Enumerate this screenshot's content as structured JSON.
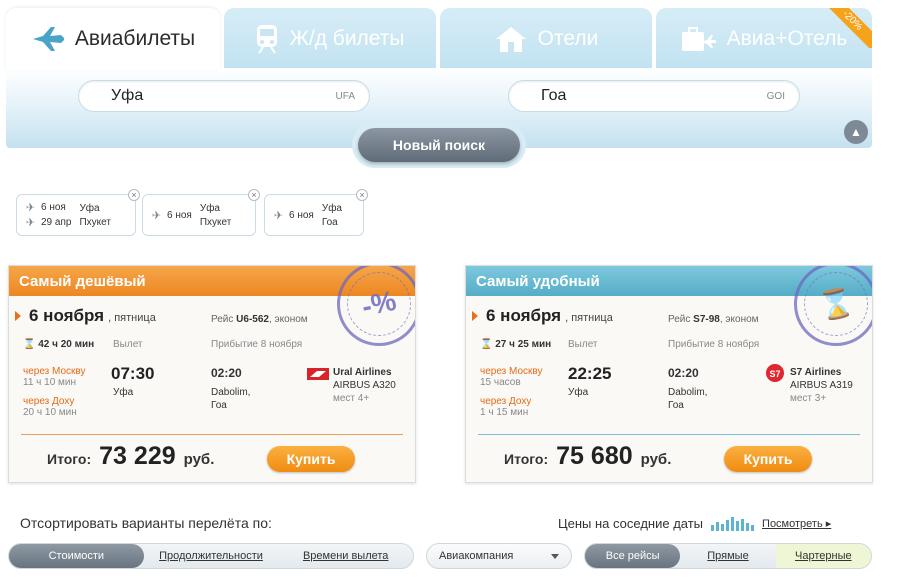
{
  "tabs": [
    {
      "label": "Авиабилеты",
      "icon": "plane-icon"
    },
    {
      "label": "Ж/д билеты",
      "icon": "train-icon"
    },
    {
      "label": "Отели",
      "icon": "house-icon"
    },
    {
      "label": "Авиа+Отель",
      "icon": "suitcase-icon",
      "badge": "-20%"
    }
  ],
  "search": {
    "from": {
      "city": "Уфа",
      "code": "UFA"
    },
    "to": {
      "city": "Гоа",
      "code": "GOI"
    },
    "new_search_label": "Новый поиск"
  },
  "history": [
    {
      "rows": [
        {
          "date": "6 ноя",
          "city": "Уфа"
        },
        {
          "date": "29 апр",
          "city": "Пхукет"
        }
      ]
    },
    {
      "rows": [
        {
          "date": "6 ноя",
          "city": "Уфа"
        },
        {
          "date": "",
          "city": "Пхукет"
        }
      ]
    },
    {
      "rows": [
        {
          "date": "6 ноя",
          "city": "Уфа"
        },
        {
          "date": "",
          "city": "Гоа"
        }
      ]
    }
  ],
  "offers": [
    {
      "title": "Самый дешёвый",
      "stamp": "-%",
      "date": "6 ноября",
      "weekday": ", пятница",
      "flight_prefix": "Рейс",
      "flight_no": "U6-562",
      "flight_class": ", эконом",
      "duration": "42 ч 20 мин",
      "departure_label": "Вылет",
      "arrival_label": "Прибытие 8 ноября",
      "via1": {
        "text": "через Москву",
        "stop": "11 ч 10 мин"
      },
      "via2": {
        "text": "через Доху",
        "stop": "20 ч 10 мин"
      },
      "dep_time": "07:30",
      "dep_city": "Уфа",
      "arr_time": "02:20",
      "arr_city1": "Dabolim,",
      "arr_city2": "Гоа",
      "airline": "Ural Airlines",
      "aircraft": "AIRBUS A320",
      "seats": "мест 4+",
      "total_label": "Итого:",
      "price": "73 229",
      "currency": "руб.",
      "buy_label": "Купить",
      "accent": "#ec8722"
    },
    {
      "title": "Самый удобный",
      "stamp": "⌛",
      "date": "6 ноября",
      "weekday": ", пятница",
      "flight_prefix": "Рейс",
      "flight_no": "S7-98",
      "flight_class": ", эконом",
      "duration": "27 ч 25 мин",
      "departure_label": "Вылет",
      "arrival_label": "Прибытие 8 ноября",
      "via1": {
        "text": "через Москву",
        "stop": "15 часов"
      },
      "via2": {
        "text": "через Доху",
        "stop": "1 ч 15 мин"
      },
      "dep_time": "22:25",
      "dep_city": "Уфа",
      "arr_time": "02:20",
      "arr_city1": "Dabolim,",
      "arr_city2": "Гоа",
      "airline": "S7 Airlines",
      "aircraft": "AIRBUS A319",
      "seats": "мест 3+",
      "total_label": "Итого:",
      "price": "75 680",
      "currency": "руб.",
      "buy_label": "Купить",
      "accent": "#55adc6"
    }
  ],
  "sort": {
    "title": "Отсортировать варианты перелёта по:",
    "options": [
      "Стоимости",
      "Продолжительности",
      "Времени вылета"
    ],
    "selected": "Стоимости"
  },
  "nearby_dates": {
    "label": "Цены на соседние даты",
    "link": "Посмотреть ▸"
  },
  "airline_select": {
    "value": "Авиакомпания"
  },
  "flight_type": {
    "options": [
      "Все рейсы",
      "Прямые",
      "Чартерные"
    ],
    "selected": "Все рейсы"
  }
}
